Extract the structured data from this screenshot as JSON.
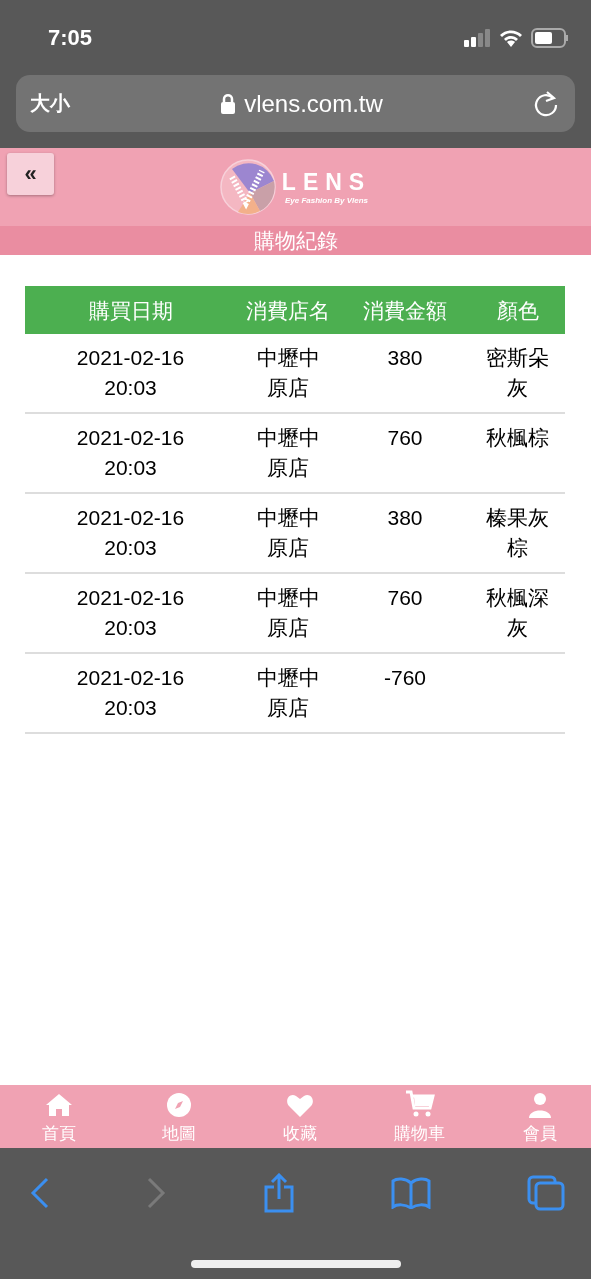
{
  "status_bar": {
    "time": "7:05"
  },
  "address_bar": {
    "text_size_button": "大小",
    "url": "vlens.com.tw"
  },
  "header": {
    "back_button": "«",
    "brand": "LENS",
    "tagline": "Eye Fashion By Vlens",
    "page_title": "購物紀錄"
  },
  "table": {
    "columns": [
      "購買日期",
      "消費店名",
      "消費金額",
      "顏色"
    ],
    "rows": [
      {
        "cells": [
          "2021-02-16 20:03",
          "中壢中原店",
          "380",
          "密斯朵灰"
        ]
      },
      {
        "cells": [
          "2021-02-16 20:03",
          "中壢中原店",
          "760",
          "秋楓棕"
        ]
      },
      {
        "cells": [
          "2021-02-16 20:03",
          "中壢中原店",
          "380",
          "榛果灰棕"
        ]
      },
      {
        "cells": [
          "2021-02-16 20:03",
          "中壢中原店",
          "760",
          "秋楓深灰"
        ]
      },
      {
        "cells": [
          "2021-02-16 20:03",
          "中壢中原店",
          "-760"
        ]
      }
    ]
  },
  "tab_bar": [
    {
      "kind": "home",
      "label": "首頁"
    },
    {
      "kind": "compass",
      "label": "地圖"
    },
    {
      "kind": "heart",
      "label": "收藏"
    },
    {
      "kind": "cart",
      "label": "購物車"
    },
    {
      "kind": "user",
      "label": "會員"
    }
  ],
  "browser_toolbar": [
    {
      "kind": "back",
      "disabled": false
    },
    {
      "kind": "forward",
      "disabled": true
    },
    {
      "kind": "share",
      "disabled": false
    },
    {
      "kind": "bookmarks",
      "disabled": false
    },
    {
      "kind": "tabs",
      "disabled": false
    }
  ]
}
